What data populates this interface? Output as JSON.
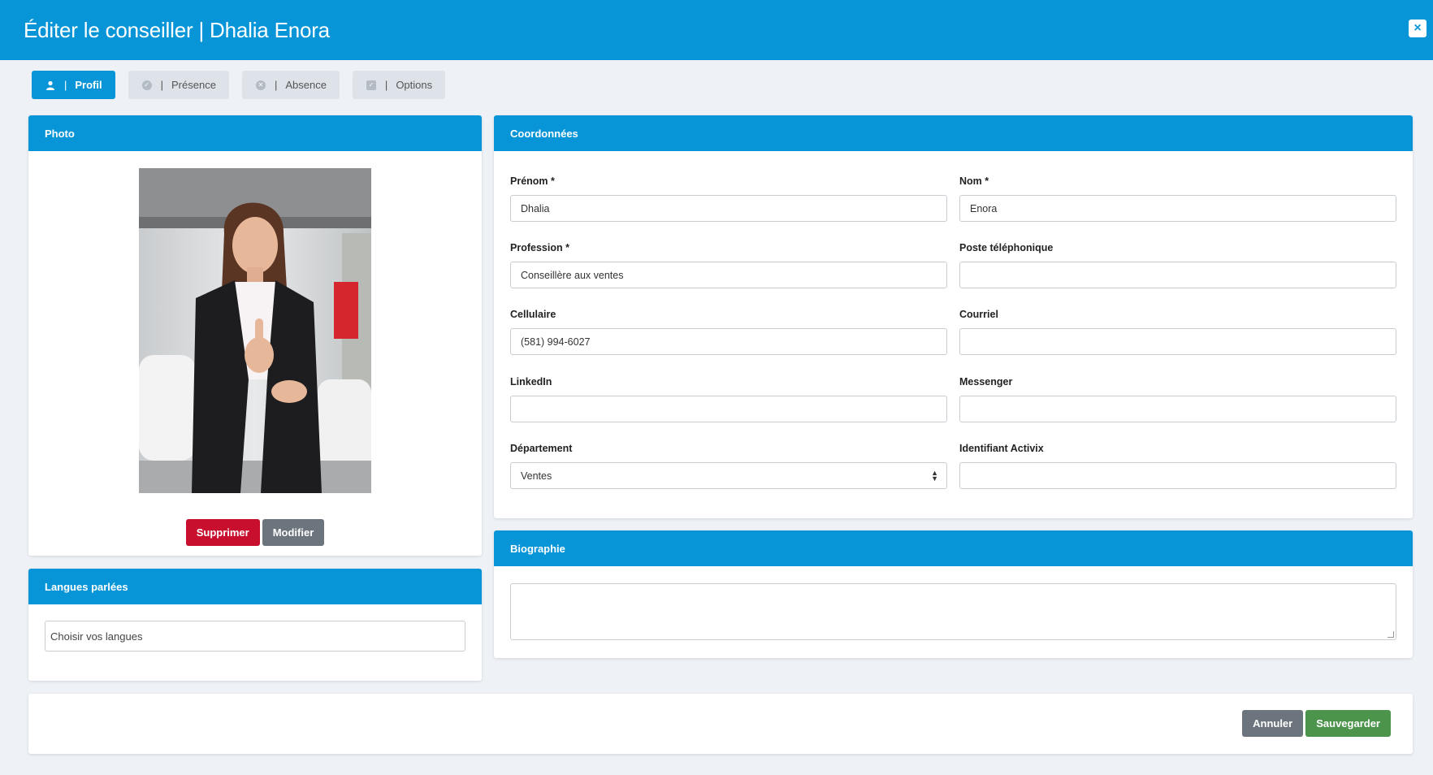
{
  "header": {
    "title": "Éditer le conseiller | Dhalia Enora",
    "close_label": "×"
  },
  "tabs": [
    {
      "label": "Profil",
      "icon": "user-icon",
      "active": true
    },
    {
      "label": "Présence",
      "icon": "check-circle-icon",
      "active": false
    },
    {
      "label": "Absence",
      "icon": "x-circle-icon",
      "active": false
    },
    {
      "label": "Options",
      "icon": "checkbox-icon",
      "active": false
    }
  ],
  "tab_separator": "|",
  "photo": {
    "header": "Photo",
    "delete_label": "Supprimer",
    "edit_label": "Modifier"
  },
  "langues": {
    "header": "Langues parlées",
    "placeholder": "Choisir vos langues"
  },
  "coordonnees": {
    "header": "Coordonnées",
    "fields": {
      "prenom": {
        "label": "Prénom *",
        "value": "Dhalia"
      },
      "nom": {
        "label": "Nom *",
        "value": "Enora"
      },
      "profession": {
        "label": "Profession *",
        "value": "Conseillère aux ventes"
      },
      "poste": {
        "label": "Poste téléphonique",
        "value": ""
      },
      "cellulaire": {
        "label": "Cellulaire",
        "value": "(581) 994-6027"
      },
      "courriel": {
        "label": "Courriel",
        "value": ""
      },
      "linkedin": {
        "label": "LinkedIn",
        "value": ""
      },
      "messenger": {
        "label": "Messenger",
        "value": ""
      },
      "departement": {
        "label": "Département",
        "value": "Ventes"
      },
      "activix": {
        "label": "Identifiant Activix",
        "value": ""
      }
    }
  },
  "biographie": {
    "header": "Biographie",
    "value": ""
  },
  "footer": {
    "cancel_label": "Annuler",
    "save_label": "Sauvegarder"
  },
  "colors": {
    "primary": "#0795d8",
    "danger": "#c8102e",
    "secondary": "#6c757d",
    "success": "#4c934c"
  }
}
